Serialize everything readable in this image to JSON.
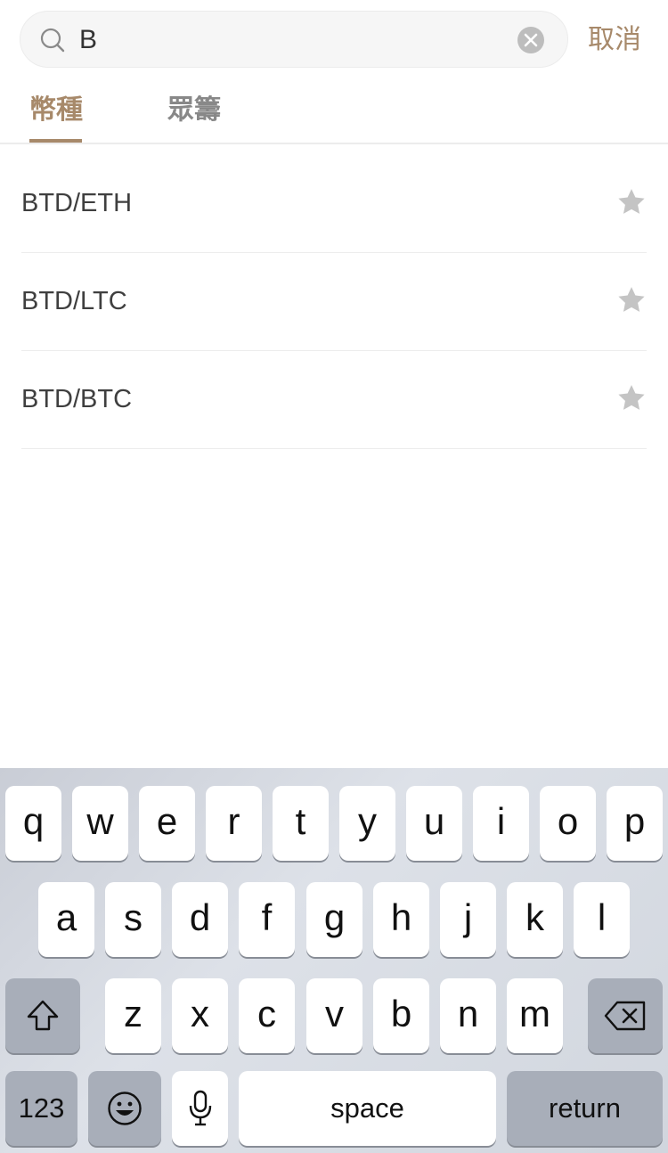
{
  "search": {
    "value": "B",
    "cancel_label": "取消"
  },
  "tabs": [
    {
      "label": "幣種",
      "active": true
    },
    {
      "label": "眾籌",
      "active": false
    }
  ],
  "results": [
    {
      "pair": "BTD/ETH",
      "favorited": false
    },
    {
      "pair": "BTD/LTC",
      "favorited": false
    },
    {
      "pair": "BTD/BTC",
      "favorited": false
    }
  ],
  "keyboard": {
    "row1": [
      "q",
      "w",
      "e",
      "r",
      "t",
      "y",
      "u",
      "i",
      "o",
      "p"
    ],
    "row2": [
      "a",
      "s",
      "d",
      "f",
      "g",
      "h",
      "j",
      "k",
      "l"
    ],
    "row3": [
      "z",
      "x",
      "c",
      "v",
      "b",
      "n",
      "m"
    ],
    "numbers_label": "123",
    "space_label": "space",
    "return_label": "return"
  },
  "colors": {
    "accent": "#a7896a",
    "star_inactive": "#c4c4c4",
    "divider": "#ececec"
  },
  "icons": {
    "search": "search-icon",
    "clear": "clear-icon",
    "star": "star-icon",
    "shift": "shift-icon",
    "delete": "delete-icon",
    "emoji": "emoji-icon",
    "mic": "microphone-icon"
  }
}
